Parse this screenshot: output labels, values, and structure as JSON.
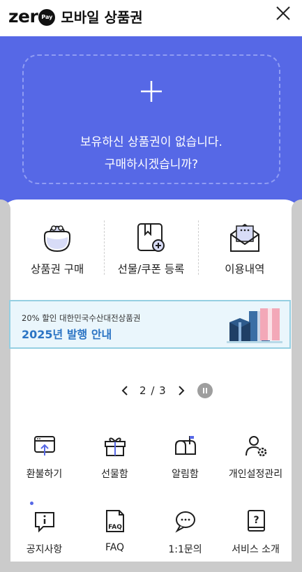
{
  "header": {
    "logo_word": "zer",
    "logo_badge": "Pay",
    "title": "모바일 상품권"
  },
  "hero": {
    "line1": "보유하신 상품권이 없습니다.",
    "line2": "구매하시겠습니까?"
  },
  "main_actions": [
    {
      "label": "상품권 구매",
      "icon": "wallet-icon"
    },
    {
      "label": "선물/쿠폰 등록",
      "icon": "gift-card-add-icon"
    },
    {
      "label": "이용내역",
      "icon": "envelope-icon"
    }
  ],
  "banner": {
    "subtitle": "20% 할인 대한민국수산대전상품권",
    "title": "2025년 발행 안내"
  },
  "pager": {
    "current": "2",
    "separator": "/",
    "total": "3"
  },
  "menu": [
    {
      "label": "환불하기",
      "icon": "refund-icon"
    },
    {
      "label": "선물함",
      "icon": "gift-box-icon"
    },
    {
      "label": "알림함",
      "icon": "mailbox-icon"
    },
    {
      "label": "개인설정관리",
      "icon": "user-settings-icon"
    },
    {
      "label": "공지사항",
      "icon": "notice-icon"
    },
    {
      "label": "FAQ",
      "icon": "faq-icon"
    },
    {
      "label": "1:1문의",
      "icon": "chat-icon"
    },
    {
      "label": "서비스 소개",
      "icon": "book-question-icon"
    }
  ],
  "colors": {
    "hero_bg": "#5668e6",
    "banner_bg": "#eaf6fc",
    "banner_title": "#2b74c4",
    "accent_icon": "#5668e6"
  }
}
